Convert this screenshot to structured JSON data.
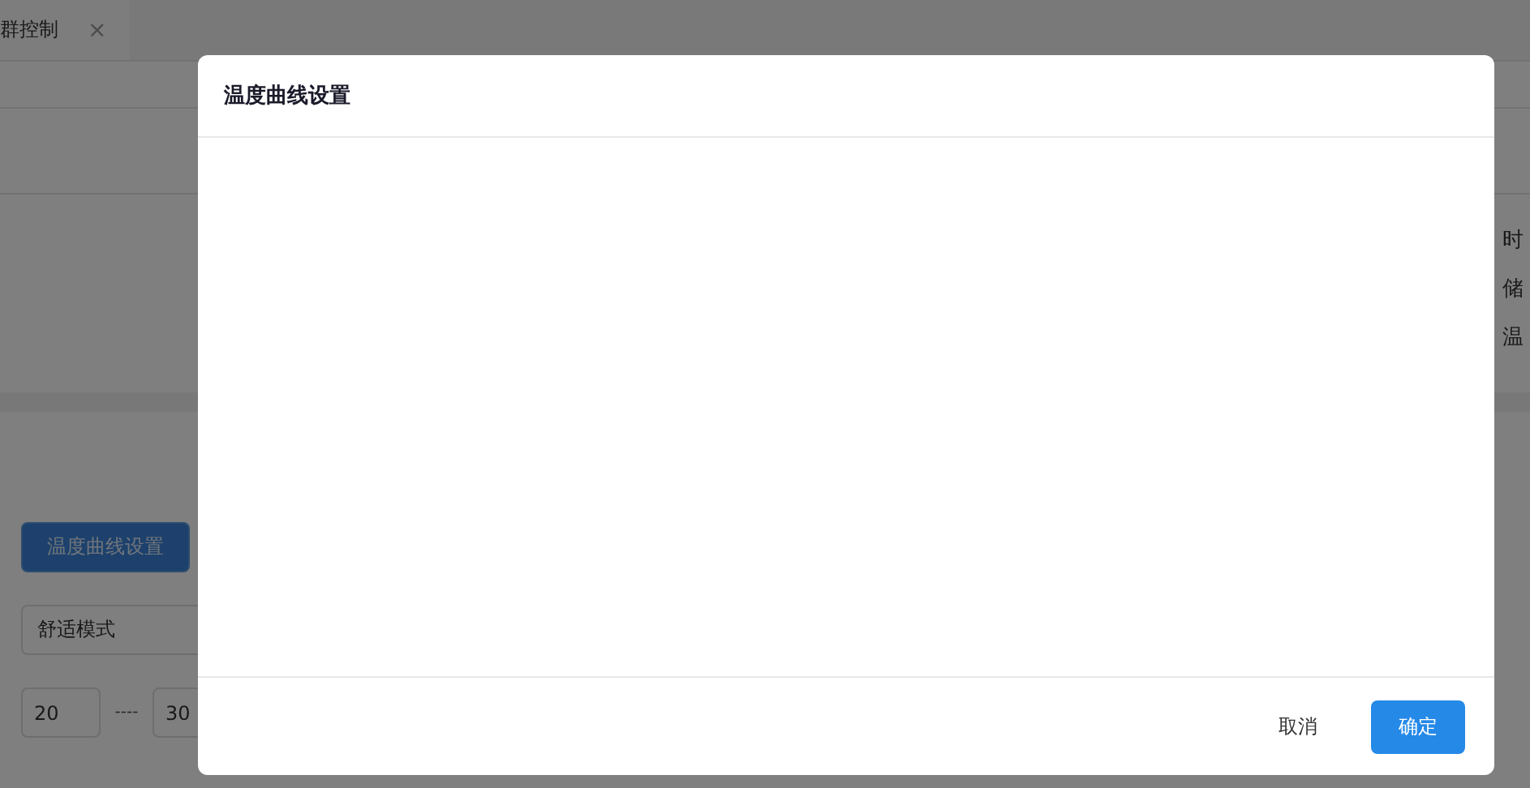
{
  "tabs": [
    {
      "label": "群控制",
      "close": "×"
    }
  ],
  "side_labels": [
    "时",
    "储",
    "温"
  ],
  "curve_button": "温度曲线设置",
  "mode_select": {
    "value": "舒适模式"
  },
  "range": {
    "min": "20",
    "separator": "----",
    "max": "30"
  },
  "dialog": {
    "title": "温度曲线设置",
    "buttons": [
      {
        "label": "取消",
        "kind": "default"
      },
      {
        "label": "确定",
        "kind": "primary"
      }
    ]
  }
}
